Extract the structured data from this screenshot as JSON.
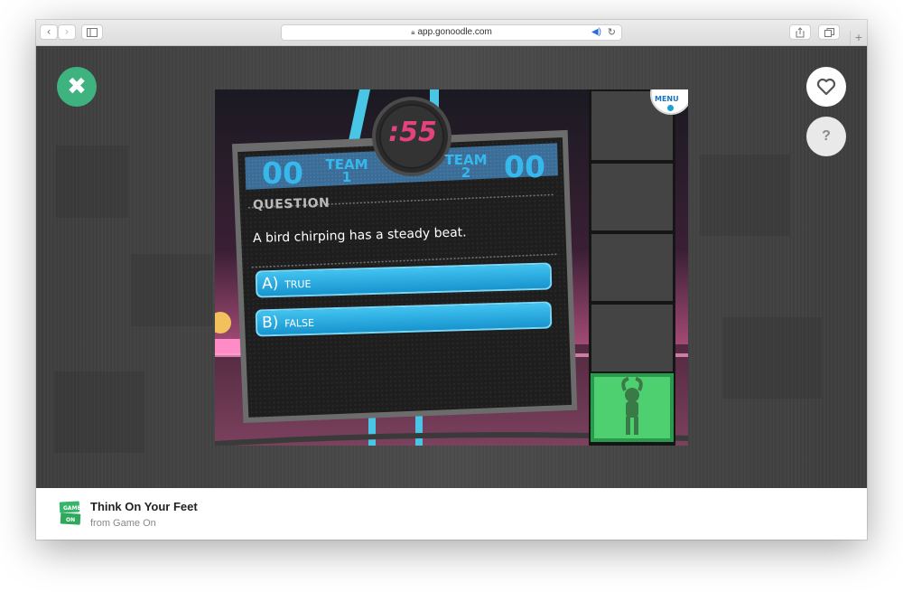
{
  "browser": {
    "url": "app.gonoodle.com",
    "back_glyph": "‹",
    "forward_glyph": "›",
    "new_tab_glyph": "+"
  },
  "controls": {
    "close_glyph": "✖",
    "help_label": "?"
  },
  "game": {
    "menu_label": "MENU",
    "timer": ":55",
    "team1": {
      "score": "00",
      "label_line1": "TEAM",
      "label_line2": "1"
    },
    "team2": {
      "score": "00",
      "label_line1": "TEAM",
      "label_line2": "2"
    },
    "question_heading": "QUESTION",
    "question_text": "A bird chirping has a steady beat.",
    "answers": [
      {
        "letter": "A)",
        "text": "TRUE"
      },
      {
        "letter": "B)",
        "text": "FALSE"
      }
    ],
    "colors": {
      "accent_blue": "#1e9fd6",
      "timer_pink": "#e2427e",
      "score_blue": "#36b8ec",
      "active_green": "#4fd070"
    }
  },
  "footer": {
    "title": "Think On Your Feet",
    "subtitle": "from Game On",
    "logo_line1": "GAME",
    "logo_line2": "ON"
  }
}
